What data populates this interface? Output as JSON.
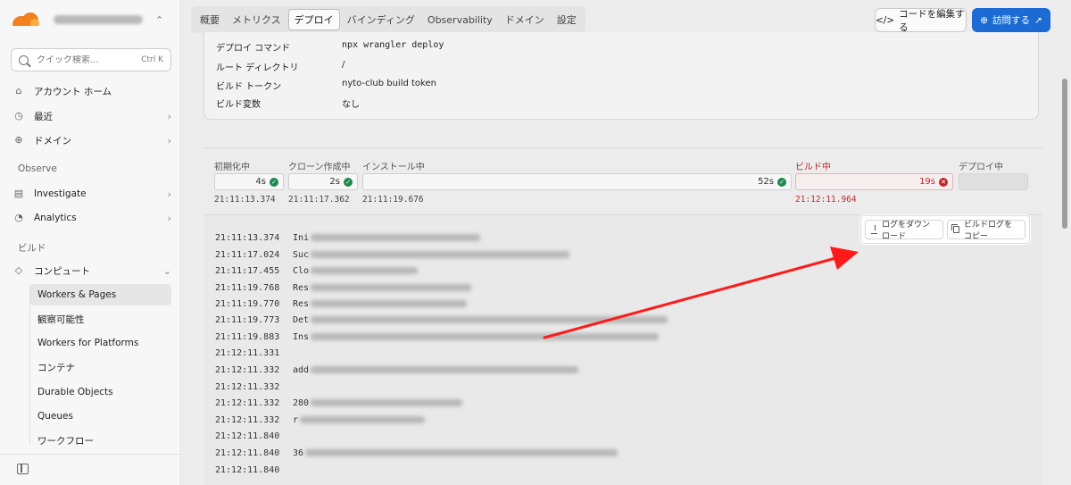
{
  "sidebar": {
    "search_placeholder": "クイック検索...",
    "search_shortcut": "Ctrl K",
    "account_home": "アカウント ホーム",
    "recent": "最近",
    "domains": "ドメイン",
    "section_observe": "Observe",
    "investigate": "Investigate",
    "analytics": "Analytics",
    "section_build": "ビルド",
    "compute": "コンピュート",
    "sub_items": [
      "Workers & Pages",
      "観察可能性",
      "Workers for Platforms",
      "コンテナ",
      "Durable Objects",
      "Queues",
      "ワークフロー"
    ]
  },
  "header": {
    "tabs": [
      "概要",
      "メトリクス",
      "デプロイ",
      "バインディング",
      "Observability",
      "ドメイン",
      "設定"
    ],
    "active_tab": "デプロイ",
    "edit_code": "コードを編集する",
    "visit": "訪問する"
  },
  "config": {
    "rows": [
      {
        "label": "デプロイ コマンド",
        "value": "npx wrangler deploy"
      },
      {
        "label": "ルート ディレクトリ",
        "value": "/"
      },
      {
        "label": "ビルド トークン",
        "value": "nyto-club build token"
      },
      {
        "label": "ビルド変数",
        "value": "なし"
      }
    ]
  },
  "stages": [
    {
      "name": "初期化中",
      "duration": "4s",
      "time": "21:11:13.374",
      "status": "ok"
    },
    {
      "name": "クローン作成中",
      "duration": "2s",
      "time": "21:11:17.362",
      "status": "ok"
    },
    {
      "name": "インストール中",
      "duration": "52s",
      "time": "21:11:19.676",
      "status": "ok"
    },
    {
      "name": "ビルド中",
      "duration": "19s",
      "time": "21:12:11.964",
      "status": "error"
    },
    {
      "name": "デプロイ中",
      "duration": "",
      "time": "",
      "status": "pending"
    }
  ],
  "log_actions": {
    "download": "ログをダウンロード",
    "copy": "ビルドログをコピー"
  },
  "logs": [
    {
      "ts": "21:11:13.374",
      "msg": "Ini"
    },
    {
      "ts": "21:11:17.024",
      "msg": "Suc"
    },
    {
      "ts": "21:11:17.455",
      "msg": "Clo"
    },
    {
      "ts": "21:11:19.768",
      "msg": "Res"
    },
    {
      "ts": "21:11:19.770",
      "msg": "Res"
    },
    {
      "ts": "21:11:19.773",
      "msg": "Det"
    },
    {
      "ts": "21:11:19.883",
      "msg": "Ins"
    },
    {
      "ts": "21:12:11.331",
      "msg": ""
    },
    {
      "ts": "21:12:11.332",
      "msg": "add"
    },
    {
      "ts": "21:12:11.332",
      "msg": ""
    },
    {
      "ts": "21:12:11.332",
      "msg": "280"
    },
    {
      "ts": "21:12:11.332",
      "msg": "  r"
    },
    {
      "ts": "21:12:11.840",
      "msg": ""
    },
    {
      "ts": "21:12:11.840",
      "msg": "36"
    },
    {
      "ts": "21:12:11.840",
      "msg": ""
    }
  ]
}
